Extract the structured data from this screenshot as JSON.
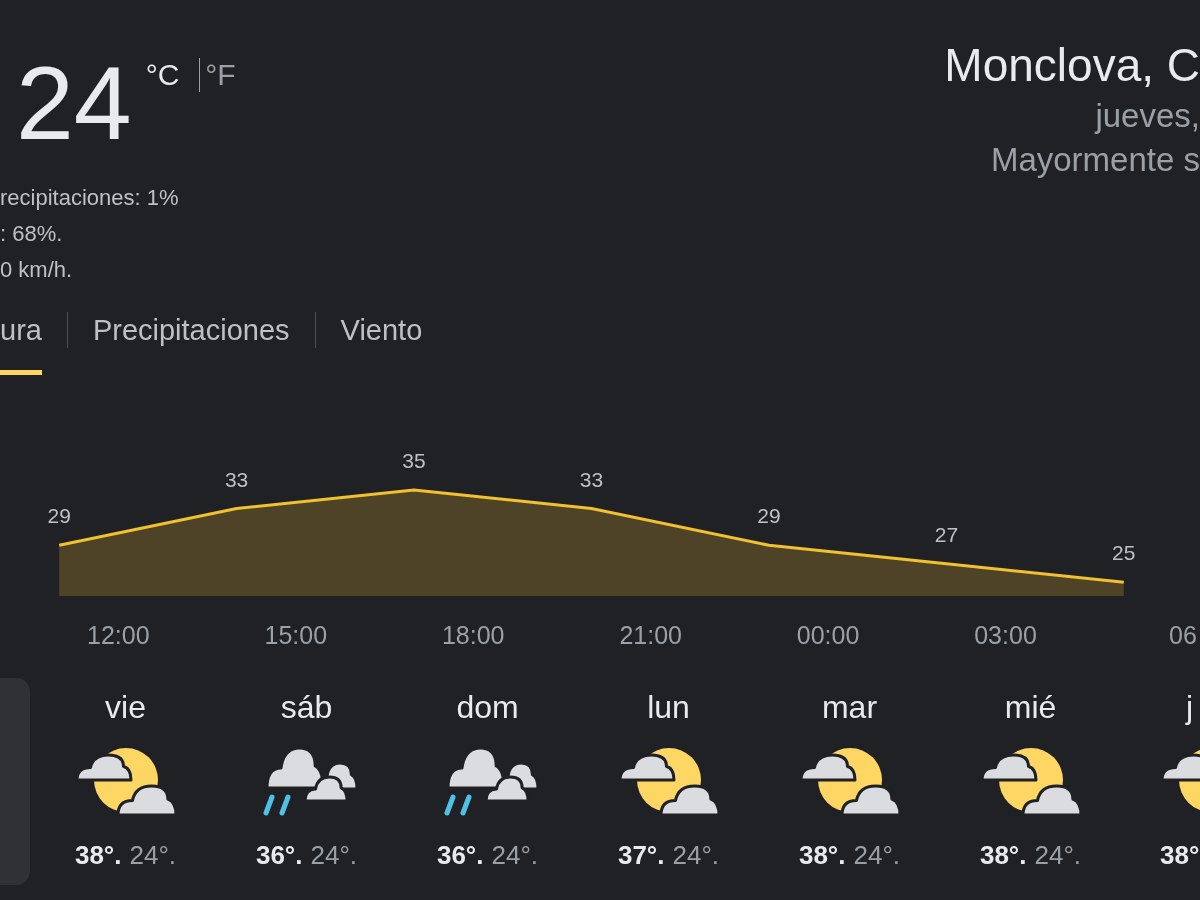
{
  "current": {
    "temperature": "24",
    "units": [
      {
        "label": "°C",
        "selected": true
      },
      {
        "label": "°F",
        "selected": false
      }
    ],
    "details": [
      "recipitaciones: 1%",
      ": 68%.",
      "0 km/h."
    ]
  },
  "location": {
    "title": "Monclova, C",
    "date": "jueves,",
    "condition": "Mayormente s"
  },
  "tabs": [
    {
      "label": "ura",
      "selected": true
    },
    {
      "label": "Precipitaciones",
      "selected": false
    },
    {
      "label": "Viento",
      "selected": false
    }
  ],
  "chart": {
    "chart_data": {
      "type": "area",
      "data_labels": true,
      "categories": [
        null,
        null,
        "12:00",
        null,
        null,
        "15:00",
        null,
        null,
        "18:00",
        null,
        null,
        "21:00",
        null,
        null,
        "00:00",
        null,
        null,
        "03:00",
        null,
        null,
        "06"
      ],
      "series": [
        {
          "color": "#f2c12e",
          "values": [
            null,
            29,
            null,
            null,
            33,
            null,
            null,
            35,
            null,
            null,
            33,
            null,
            null,
            29,
            null,
            null,
            27,
            null,
            null,
            25,
            null
          ]
        }
      ]
    }
  },
  "forecast": {
    "days": [
      {
        "selected": true
      },
      {
        "label": "vie",
        "kind": "partlycloudy",
        "high": "38°.",
        "low": "24°.",
        "selected": false
      },
      {
        "label": "sáb",
        "kind": "showers",
        "high": "36°.",
        "low": "24°.",
        "selected": false
      },
      {
        "label": "dom",
        "kind": "showers",
        "high": "36°.",
        "low": "24°.",
        "selected": false
      },
      {
        "label": "lun",
        "kind": "partlycloudy",
        "high": "37°.",
        "low": "24°.",
        "selected": false
      },
      {
        "label": "mar",
        "kind": "partlycloudy",
        "high": "38°.",
        "low": "24°.",
        "selected": false
      },
      {
        "label": "mié",
        "kind": "partlycloudy",
        "high": "38°.",
        "low": "24°.",
        "selected": false
      },
      {
        "label": "j",
        "kind": "partlycloudy",
        "high": "38°",
        "selected": false
      }
    ]
  }
}
